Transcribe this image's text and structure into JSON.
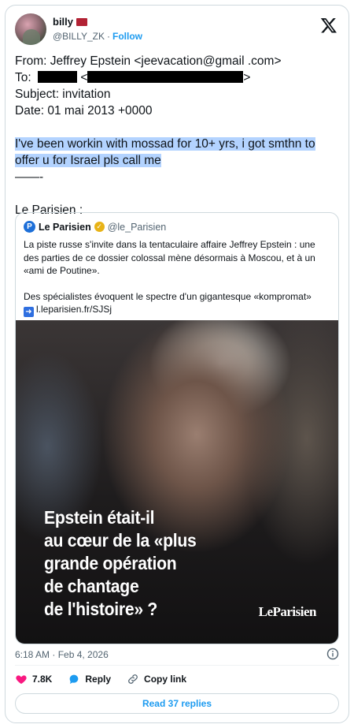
{
  "author": {
    "display_name": "billy",
    "handle": "@BILLY_ZK",
    "separator": "·",
    "follow_label": "Follow",
    "flag_color": "#b22234"
  },
  "tweet": {
    "lines": [
      "From: Jeffrey Epstein <jeevacation@gmail .com>",
      " To:",
      "<",
      ">",
      "Subject: invitation",
      "Date: 01 mai 2013 +0000",
      "I've been workin with mossad for 10+ yrs, i got smthn to",
      "offer u for Israel pls call me",
      " ——-",
      "Le Parisien :"
    ],
    "highlight_color": "#b3d3ff"
  },
  "quote": {
    "name": "Le Parisien",
    "handle": "@le_Parisien",
    "logo_letter": "P",
    "paragraph1": "La piste russe s'invite dans la tentaculaire affaire Jeffrey Epstein : une des parties de ce dossier colossal mène désormais à Moscou, et à un «ami de Poutine».",
    "paragraph2": "Des spécialistes évoquent le spectre d'un gigantesque «kompromat»",
    "link": "l.leparisien.fr/SJSj",
    "image_headline": [
      "Epstein était-il",
      "au cœur de la «plus",
      "grande opération",
      "de chantage",
      "de l'histoire» ?"
    ],
    "image_brand": "LeParisien"
  },
  "footer": {
    "timestamp": "6:18 AM · Feb 4, 2026",
    "likes": "7.8K",
    "reply_label": "Reply",
    "copy_link_label": "Copy link",
    "read_replies_label": "Read 37 replies"
  },
  "colors": {
    "accent": "#1d9bf0",
    "like": "#f91880",
    "muted": "#536471"
  }
}
